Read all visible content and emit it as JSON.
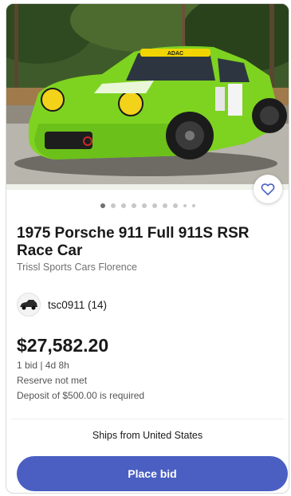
{
  "listing": {
    "title": "1975 Porsche 911 Full 911S RSR Race Car",
    "store": "Trissl Sports Cars Florence",
    "seller": "tsc0911 (14)",
    "price": "$27,582.20",
    "bids": "1 bid  |  4d 8h",
    "reserve": "Reserve not met",
    "deposit": "Deposit of $500.00 is required",
    "ships": "Ships from United States",
    "bid_button": "Place bid",
    "image_count": 10,
    "active_image": 1,
    "car_banner": "ADAC"
  },
  "colors": {
    "accent": "#4a5fc1",
    "car": "#7ed321",
    "text": "#191919",
    "muted": "#707070"
  },
  "icons": {
    "favorite": "heart-outline-icon"
  }
}
